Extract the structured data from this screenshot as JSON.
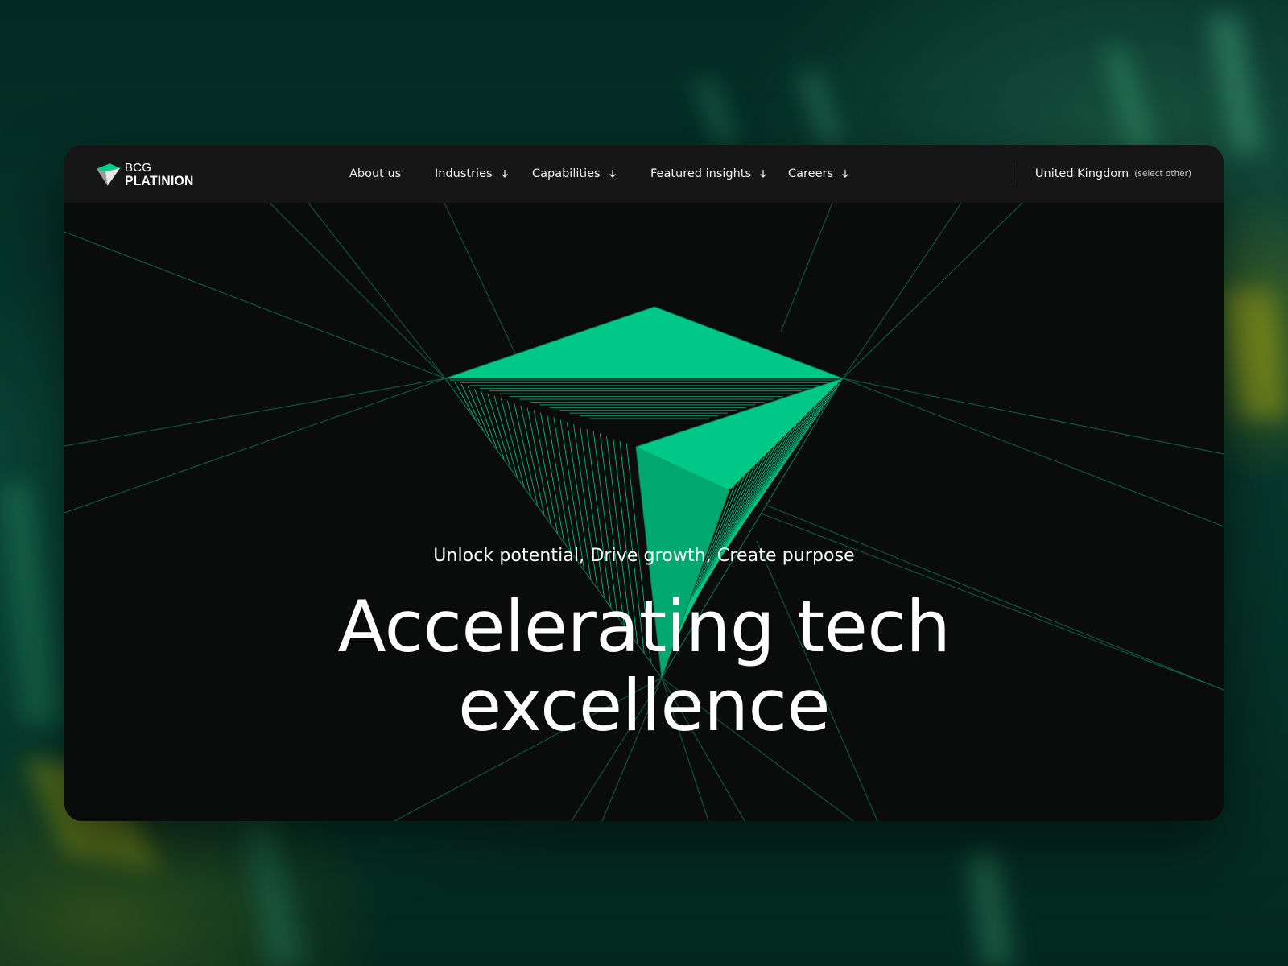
{
  "brand": {
    "name_top": "BCG",
    "name_bottom": "PLATINION"
  },
  "nav": {
    "items": [
      {
        "label": "About us",
        "has_dropdown": false
      },
      {
        "label": "Industries",
        "has_dropdown": true
      },
      {
        "label": "Capabilities",
        "has_dropdown": true
      },
      {
        "label": "Featured insights",
        "has_dropdown": true
      },
      {
        "label": "Careers",
        "has_dropdown": true
      }
    ],
    "dropdown_icon": "arrow-down-icon"
  },
  "region": {
    "name": "United Kingdom",
    "select_other": "(select other)"
  },
  "hero": {
    "subtitle": "Unlock potential, Drive growth, Create purpose",
    "title_line1": "Accelerating tech",
    "title_line2": "excellence"
  },
  "colors": {
    "accent": "#00c887",
    "accent_dark": "#00a86f",
    "navbar_bg": "#161616",
    "hero_bg": "#0a0b0b",
    "outer_bg": "#053126"
  }
}
